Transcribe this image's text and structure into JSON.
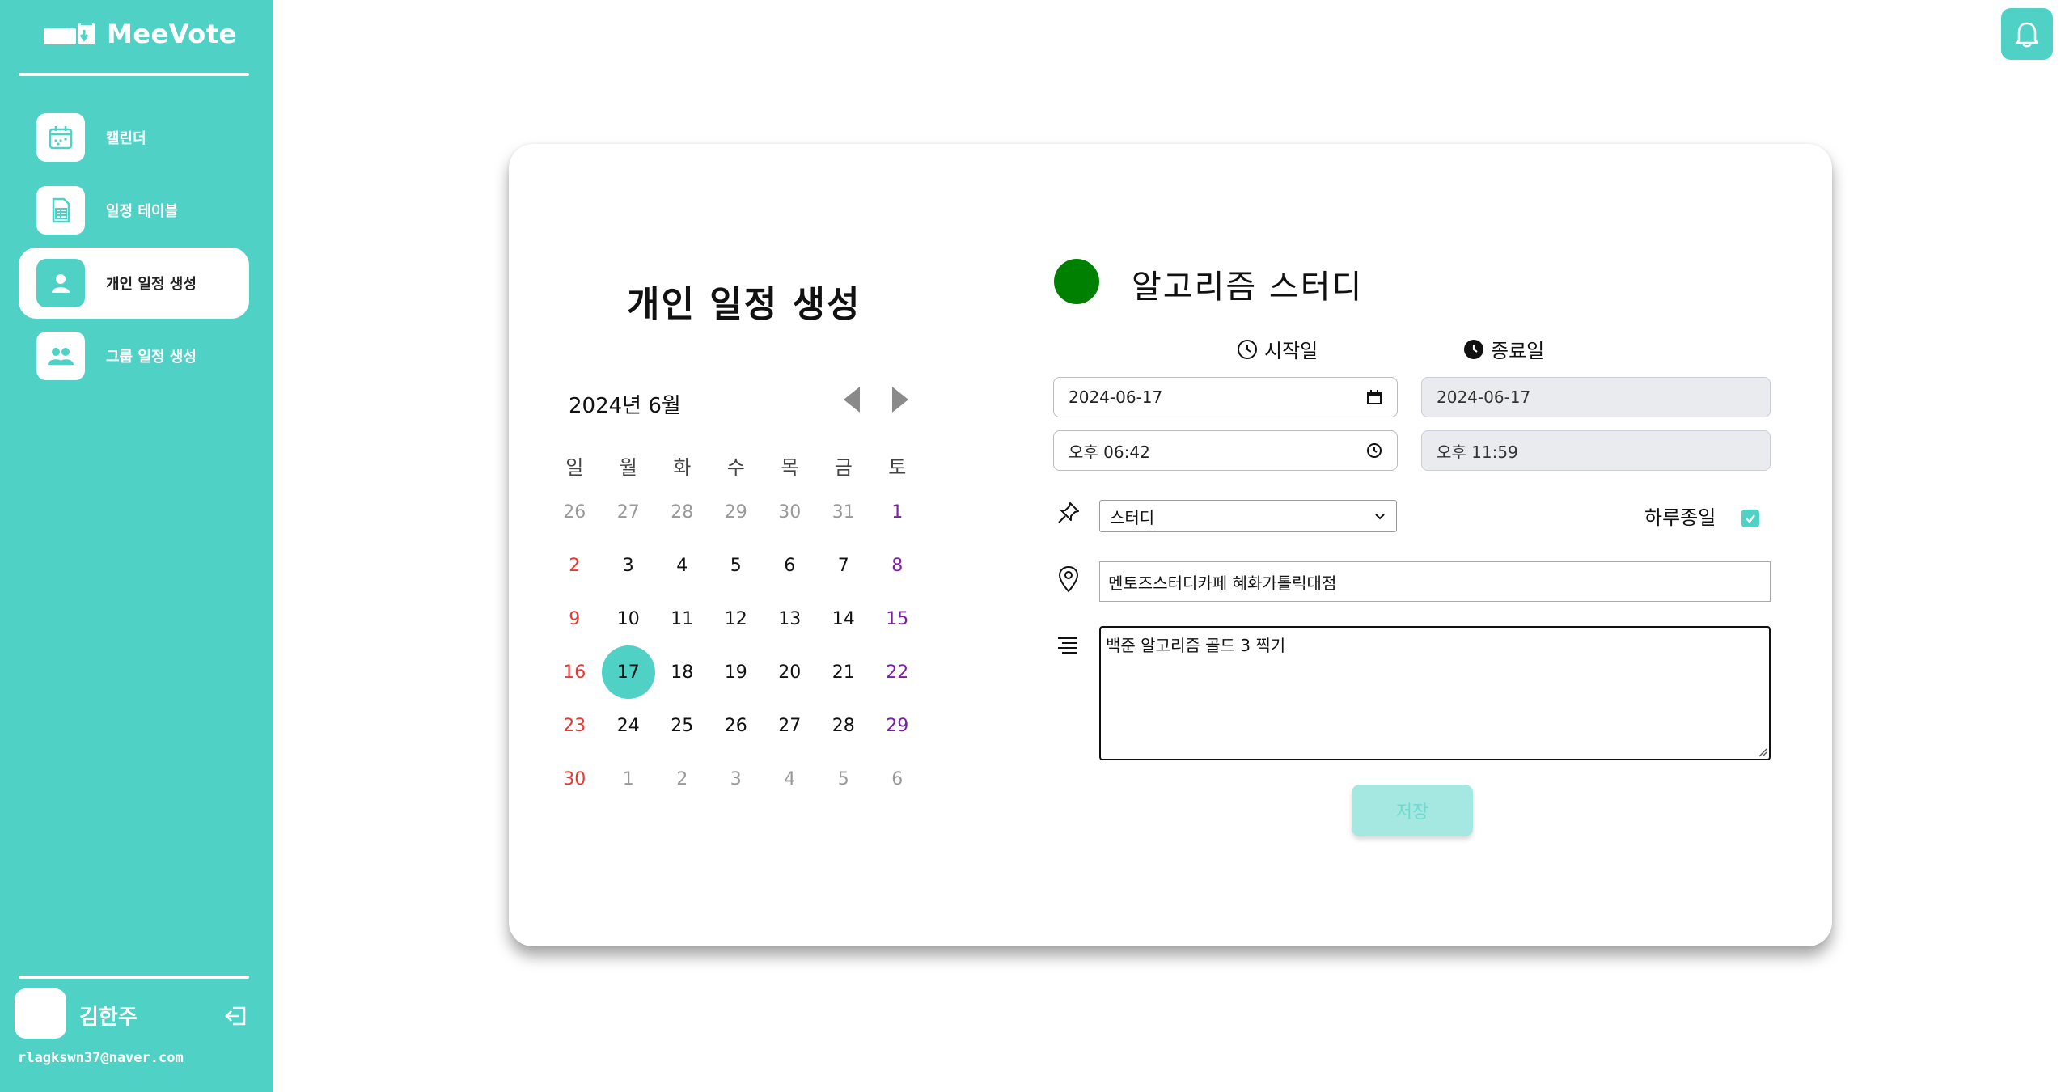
{
  "colors": {
    "accent": "#4fd1c5",
    "event_color": "#008000",
    "sunday": "#e53935",
    "saturday": "#7b1fa2"
  },
  "app": {
    "name": "MeeVote"
  },
  "sidebar": {
    "items": [
      {
        "label": "캘린더",
        "icon": "calendar-icon"
      },
      {
        "label": "일정 테이블",
        "icon": "table-icon"
      },
      {
        "label": "개인 일정 생성",
        "icon": "person-icon",
        "active": true
      },
      {
        "label": "그룹 일정 생성",
        "icon": "group-icon"
      }
    ]
  },
  "user": {
    "name": "김한주",
    "email": "rlagkswn37@naver.com"
  },
  "page": {
    "title": "개인 일정 생성"
  },
  "calendar": {
    "month_label": "2024년 6월",
    "weekdays": [
      "일",
      "월",
      "화",
      "수",
      "목",
      "금",
      "토"
    ],
    "selected_day": "17",
    "weeks": [
      [
        "26",
        "27",
        "28",
        "29",
        "30",
        "31",
        "1"
      ],
      [
        "2",
        "3",
        "4",
        "5",
        "6",
        "7",
        "8"
      ],
      [
        "9",
        "10",
        "11",
        "12",
        "13",
        "14",
        "15"
      ],
      [
        "16",
        "17",
        "18",
        "19",
        "20",
        "21",
        "22"
      ],
      [
        "23",
        "24",
        "25",
        "26",
        "27",
        "28",
        "29"
      ],
      [
        "30",
        "1",
        "2",
        "3",
        "4",
        "5",
        "6"
      ]
    ]
  },
  "form": {
    "event_title": "알고리즘 스터디",
    "start_label": "시작일",
    "end_label": "종료일",
    "start_date": "2024-06-17",
    "end_date": "2024-06-17",
    "start_time": "오후 06:42",
    "end_time": "오후 11:59",
    "category": "스터디",
    "allday_label": "하루종일",
    "allday_checked": true,
    "location": "멘토즈스터디카페 혜화가톨릭대점",
    "memo": "백준 알고리즘 골드 3 찍기",
    "save_label": "저장"
  }
}
